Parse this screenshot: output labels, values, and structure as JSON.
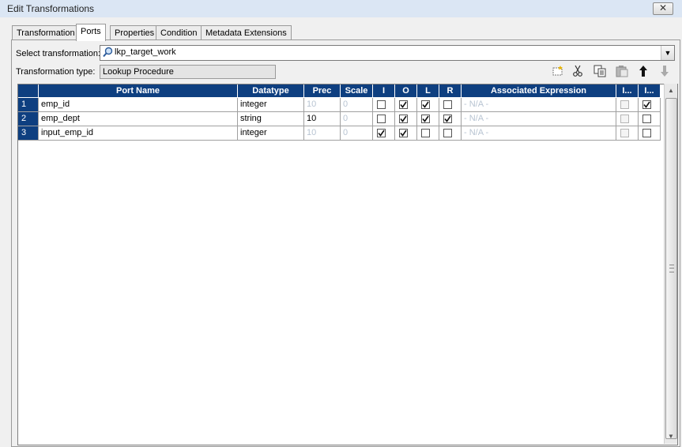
{
  "window": {
    "title": "Edit Transformations",
    "close_glyph": "✕"
  },
  "tabs": [
    {
      "label": "Transformation"
    },
    {
      "label": "Ports"
    },
    {
      "label": "Properties"
    },
    {
      "label": "Condition"
    },
    {
      "label": "Metadata Extensions"
    }
  ],
  "active_tab": "Ports",
  "select_transformation": {
    "label": "Select transformation:",
    "value": "lkp_target_work"
  },
  "transformation_type": {
    "label": "Transformation type:",
    "value": "Lookup Procedure"
  },
  "toolbar": {
    "icons": [
      "new-port-icon",
      "cut-icon",
      "copy-icon",
      "paste-icon",
      "move-up-icon",
      "move-down-icon"
    ]
  },
  "grid": {
    "columns": [
      "Port Name",
      "Datatype",
      "Prec",
      "Scale",
      "I",
      "O",
      "L",
      "R",
      "Associated Expression",
      "I...",
      "I..."
    ],
    "rows": [
      {
        "num": "1",
        "name": "emp_id",
        "datatype": "integer",
        "prec": "10",
        "scale": "0",
        "I": false,
        "O": true,
        "L": true,
        "R": false,
        "expr": "- N/A -",
        "c1": false,
        "c2": true
      },
      {
        "num": "2",
        "name": "emp_dept",
        "datatype": "string",
        "prec": "10",
        "scale": "0",
        "I": false,
        "O": true,
        "L": true,
        "R": true,
        "expr": "- N/A -",
        "c1": false,
        "c2": false
      },
      {
        "num": "3",
        "name": "input_emp_id",
        "datatype": "integer",
        "prec": "10",
        "scale": "0",
        "I": true,
        "O": true,
        "L": false,
        "R": false,
        "expr": "- N/A -",
        "c1": false,
        "c2": false
      }
    ]
  },
  "colors": {
    "header_bg": "#0e3f80",
    "dim_text": "#b8c4d2"
  }
}
